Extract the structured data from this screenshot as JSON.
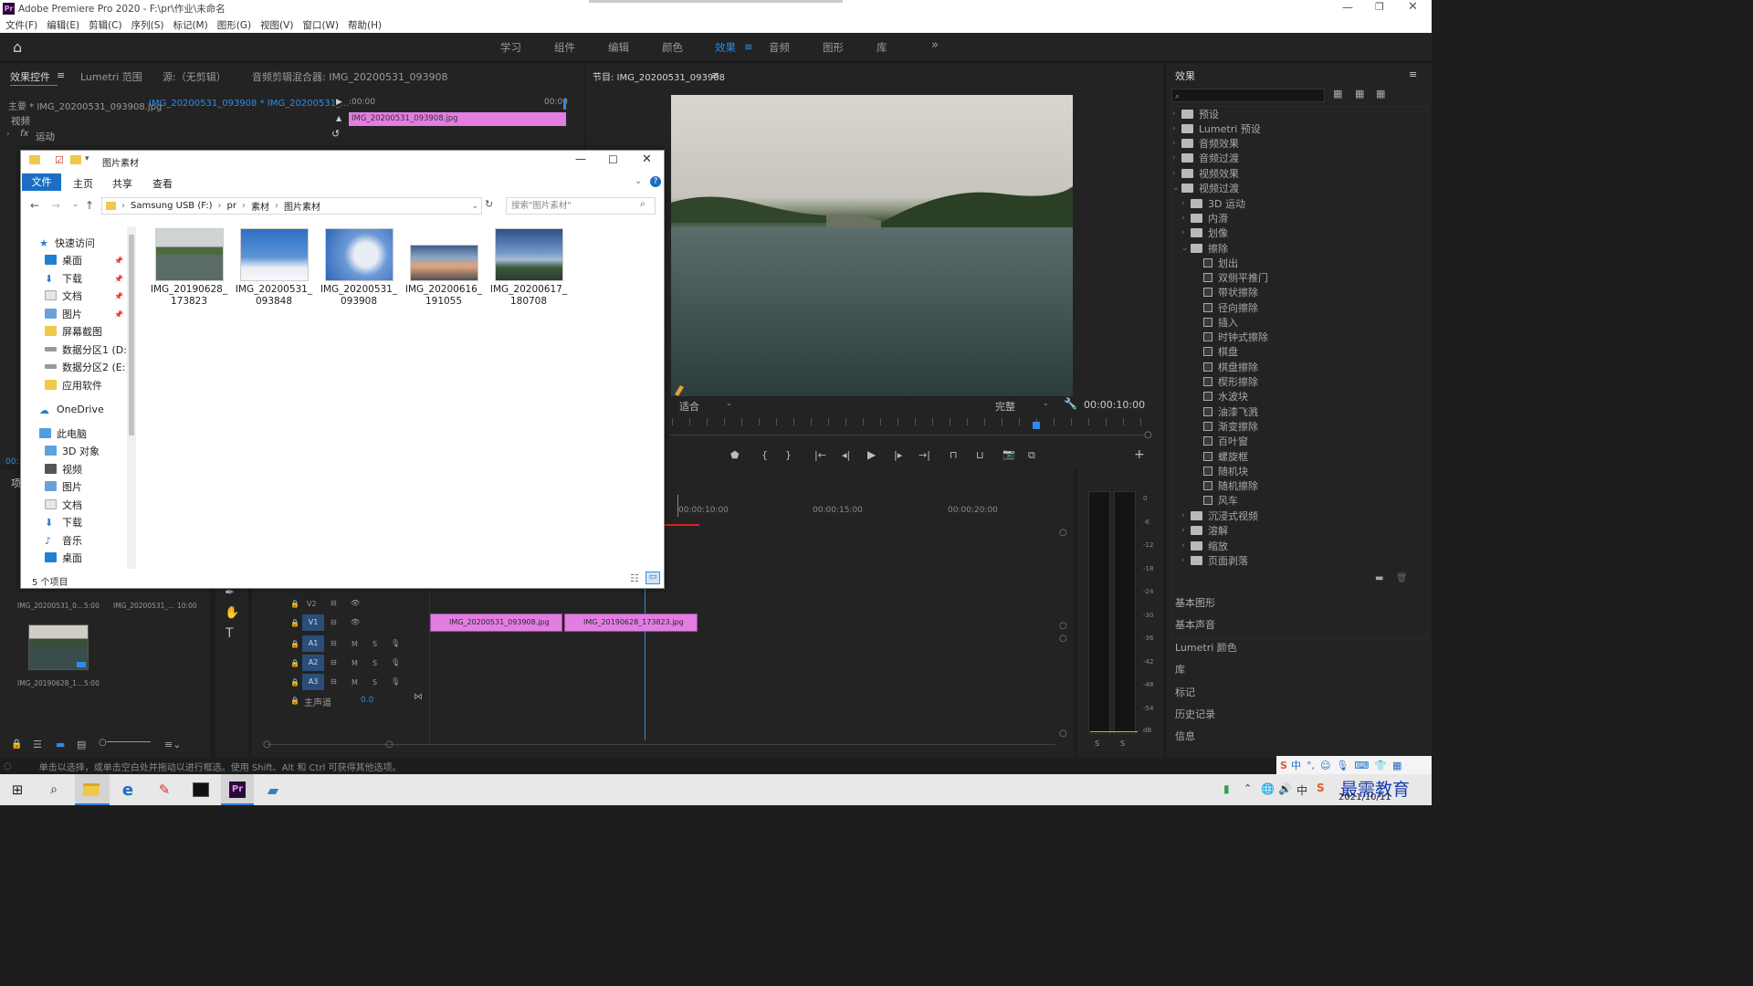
{
  "app": {
    "title": "Adobe Premiere Pro 2020 - F:\\pr\\作业\\未命名",
    "logo": "Pr"
  },
  "menu": [
    "文件(F)",
    "编辑(E)",
    "剪辑(C)",
    "序列(S)",
    "标记(M)",
    "图形(G)",
    "视图(V)",
    "窗口(W)",
    "帮助(H)"
  ],
  "workspaces": [
    "学习",
    "组件",
    "编辑",
    "颜色",
    "效果",
    "音频",
    "图形",
    "库"
  ],
  "active_workspace": "效果",
  "source_panel": {
    "tabs": [
      "效果控件",
      "Lumetri 范围",
      "源:（无剪辑）",
      "音频剪辑混合器: IMG_20200531_093908"
    ],
    "master": "主要 * IMG_20200531_093908.jpg",
    "sequence": "IMG_20200531_093908 * IMG_20200531_...",
    "time_start": ":00:00",
    "time_end": "00:00",
    "clip_name": "IMG_20200531_093908.jpg",
    "video_label": "视频",
    "motion_label": "运动",
    "fx_label": "fx"
  },
  "program": {
    "title": "节目: IMG_20200531_093908",
    "fit": "适合",
    "quality": "完整",
    "timecode": "00:00:10:00",
    "accent": "#2d8ceb"
  },
  "effects": {
    "title": "效果",
    "search_placeholder": "",
    "top_folders": [
      "预设",
      "Lumetri 预设",
      "音频效果",
      "音频过渡",
      "视频效果",
      "视频过渡"
    ],
    "video_transitions": [
      "3D 运动",
      "内滑",
      "划像",
      "擦除"
    ],
    "wipes": [
      "划出",
      "双侧平推门",
      "带状擦除",
      "径向擦除",
      "插入",
      "时钟式擦除",
      "棋盘",
      "棋盘擦除",
      "楔形擦除",
      "水波块",
      "油漆飞溅",
      "渐变擦除",
      "百叶窗",
      "螺旋框",
      "随机块",
      "随机擦除",
      "风车"
    ],
    "after": [
      "沉浸式视频",
      "溶解",
      "缩放",
      "页面剥落"
    ],
    "other_panels": [
      "基本图形",
      "基本声音",
      "Lumetri 颜色",
      "库",
      "标记",
      "历史记录",
      "信息"
    ]
  },
  "timeline": {
    "ticks": [
      "00:00:10:00",
      "00:00:15:00",
      "00:00:20:00"
    ],
    "tracks": {
      "v2": "V2",
      "v1": "V1",
      "a1": "A1",
      "a2": "A2",
      "a3": "A3",
      "master": "主声道",
      "master_val": "0.0",
      "m": "M",
      "s": "S"
    },
    "clips": [
      "IMG_20200531_093908.jpg",
      "IMG_20190628_173823.jpg"
    ],
    "clip_color": "#e27ee2"
  },
  "meter": {
    "labels": [
      "0",
      "-6",
      "-12",
      "-18",
      "-24",
      "-30",
      "-36",
      "-42",
      "-48",
      "-54",
      "dB"
    ],
    "s": "S"
  },
  "project": {
    "tab": "项",
    "items": [
      {
        "name": "IMG_20200531_0...",
        "dur": "5:00"
      },
      {
        "name": "IMG_20200531_...",
        "dur": "10:00"
      },
      {
        "name": "IMG_20190628_1...",
        "dur": "5:00"
      }
    ],
    "timecode_short": "00:"
  },
  "explorer": {
    "title": "图片素材",
    "ribbon": [
      "文件",
      "主页",
      "共享",
      "查看"
    ],
    "path": [
      "Samsung USB (F:)",
      "pr",
      "素材",
      "图片素材"
    ],
    "search_placeholder": "搜索\"图片素材\"",
    "nav": {
      "quick": "快速访问",
      "quick_items": [
        "桌面",
        "下载",
        "文档",
        "图片",
        "屏幕截图",
        "数据分区1 (D:)",
        "数据分区2 (E:)",
        "应用软件"
      ],
      "onedrive": "OneDrive",
      "pc": "此电脑",
      "pc_items": [
        "3D 对象",
        "视频",
        "图片",
        "文档",
        "下载",
        "音乐",
        "桌面"
      ]
    },
    "files": [
      {
        "l1": "IMG_20190628_",
        "l2": "173823"
      },
      {
        "l1": "IMG_20200531_",
        "l2": "093848"
      },
      {
        "l1": "IMG_20200531_",
        "l2": "093908"
      },
      {
        "l1": "IMG_20200616_",
        "l2": "191055"
      },
      {
        "l1": "IMG_20200617_",
        "l2": "180708"
      }
    ],
    "status": "5 个项目"
  },
  "status_bar": "单击以选择，或单击空白处并拖动以进行框选。使用 Shift、Alt 和 Ctrl 可获得其他选项。",
  "tray": {
    "ime": "中",
    "date": "2021/10/11",
    "watermark": "最需教育"
  }
}
